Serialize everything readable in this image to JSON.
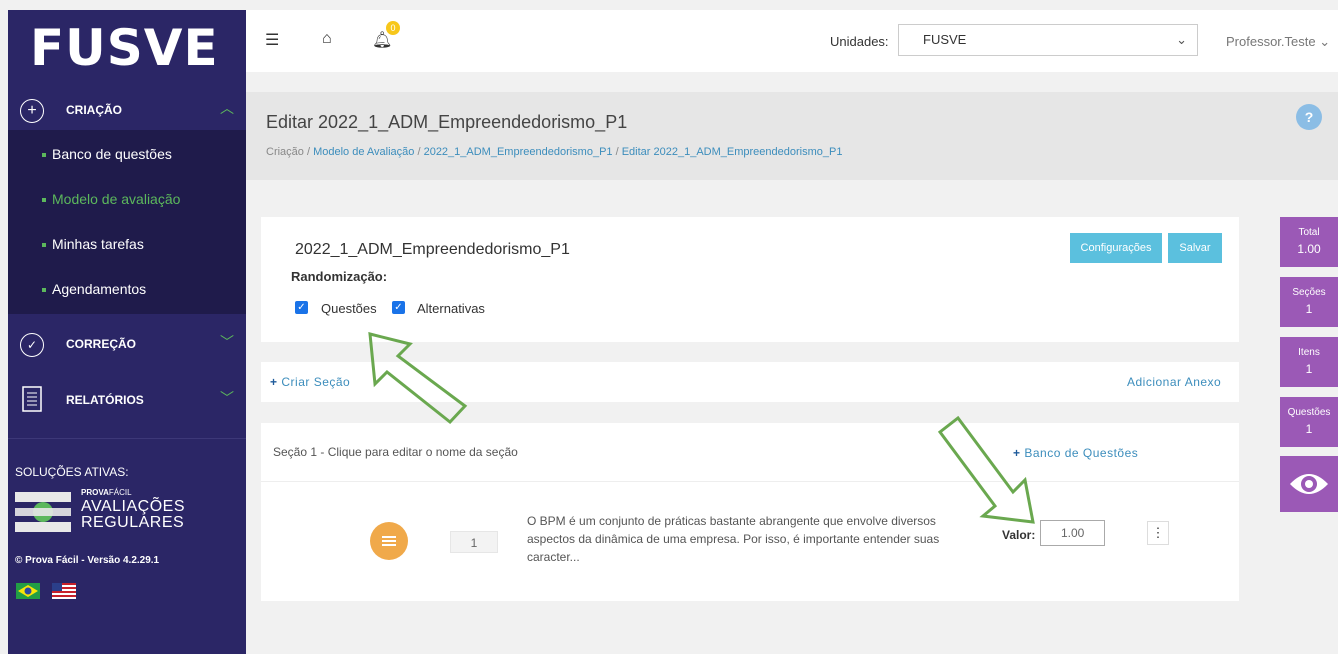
{
  "sidebar": {
    "logo": "FUSVE",
    "criacao": {
      "label": "CRIAÇÃO"
    },
    "submenu": [
      {
        "label": "Banco de questões"
      },
      {
        "label": "Modelo de avaliação"
      },
      {
        "label": "Minhas tarefas"
      },
      {
        "label": "Agendamentos"
      }
    ],
    "correcao": {
      "label": "CORREÇÃO"
    },
    "relatorios": {
      "label": "RELATÓRIOS"
    },
    "solucoes": "SOLUÇÕES ATIVAS:",
    "prova_logo": {
      "line1a": "PROVA",
      "line1b": "FÁCIL",
      "line2": "AVALIAÇÕES",
      "line3": "REGULARES"
    },
    "version": "© Prova Fácil - Versão 4.2.29.1"
  },
  "topbar": {
    "badge": "0",
    "unidades_label": "Unidades:",
    "unidade_value": "FUSVE",
    "user": "Professor.Teste"
  },
  "page": {
    "title": "Editar 2022_1_ADM_Empreendedorismo_P1",
    "breadcrumb": {
      "part1": "Criação",
      "sep": " / ",
      "part2": "Modelo de Avaliação",
      "part3": "2022_1_ADM_Empreendedorismo_P1",
      "part4": "Editar 2022_1_ADM_Empreendedorismo_P1"
    }
  },
  "model": {
    "name": "2022_1_ADM_Empreendedorismo_P1",
    "randomizacao_label": "Randomização:",
    "questoes_label": "Questões",
    "alternativas_label": "Alternativas",
    "config_button": "Configurações",
    "salvar_button": "Salvar"
  },
  "actions": {
    "criar_secao": "Criar Seção",
    "adicionar_anexo": "Adicionar Anexo"
  },
  "section": {
    "title": "Seção 1 - Clique para editar o nome da seção",
    "banco": "Banco de Questões",
    "question": {
      "number": "1",
      "text": "O BPM é um conjunto de práticas bastante abrangente que envolve diversos aspectos da dinâmica de uma empresa. Por isso, é importante entender suas caracter...",
      "valor_label": "Valor:",
      "valor_value": "1.00"
    }
  },
  "stats": [
    {
      "label": "Total",
      "value": "1.00"
    },
    {
      "label": "Seções",
      "value": "1"
    },
    {
      "label": "Itens",
      "value": "1"
    },
    {
      "label": "Questões",
      "value": "1"
    }
  ],
  "colors": {
    "sidebar": "#2b2666",
    "accent_green": "#5cb85c",
    "button_blue": "#5bc0de",
    "stat_purple": "#9b59b6",
    "arrow_green": "#6aa84f"
  }
}
